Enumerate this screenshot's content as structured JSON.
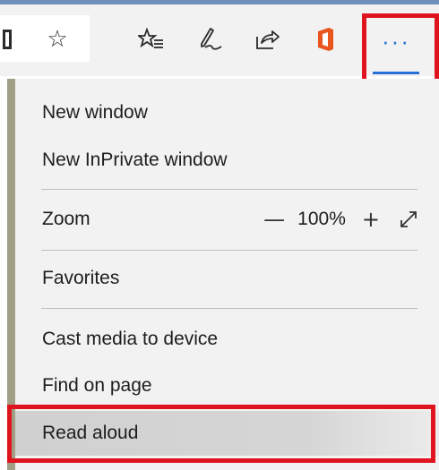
{
  "toolbar": {
    "icons": [
      "reading-view-icon",
      "favorite-star-icon",
      "hub-icon",
      "web-note-icon",
      "share-icon",
      "office-icon"
    ],
    "more_label": "···",
    "accent_color": "#2a6fd6",
    "highlight_color": "#e0141e"
  },
  "menu": {
    "new_window": "New window",
    "new_inprivate": "New InPrivate window",
    "zoom": {
      "label": "Zoom",
      "minus": "—",
      "value": "100%",
      "plus": "+"
    },
    "favorites": "Favorites",
    "cast": "Cast media to device",
    "find": "Find on page",
    "read_aloud": "Read aloud"
  }
}
